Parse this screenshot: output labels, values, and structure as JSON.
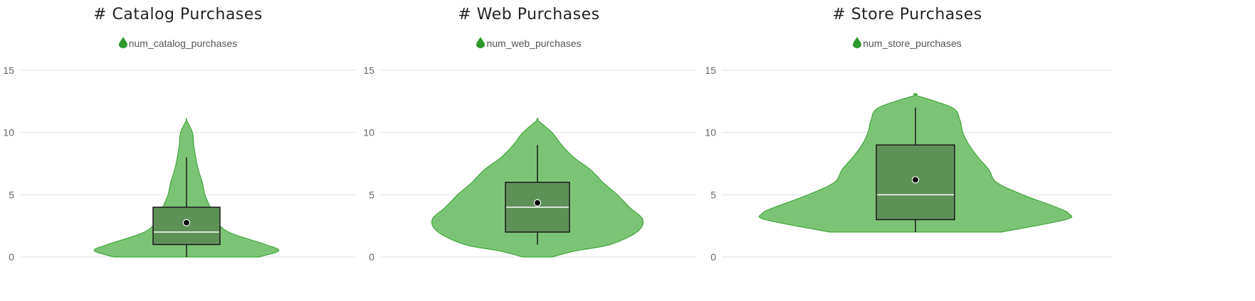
{
  "colors": {
    "violin_fill": "#7cc475",
    "violin_stroke": "#3fa63a",
    "box_fill": "#5e9158",
    "box_stroke": "#1a1a1a",
    "median": "#ffffff",
    "mean_dot": "#000000",
    "grid": "#e2e2e2",
    "legend_icon": "#2e9a2e"
  },
  "legend_icon": "droplet-icon",
  "chart_data": [
    {
      "type": "violin",
      "title": "# Catalog Purchases",
      "legend": "num_catalog_purchases",
      "ylim": [
        0,
        15
      ],
      "yticks": [
        0,
        5,
        10,
        15
      ],
      "grid": true,
      "box": {
        "min": 0,
        "q1": 1,
        "median": 2,
        "q3": 4,
        "max": 8,
        "mean": 2.75
      },
      "density": [
        [
          0,
          0.55
        ],
        [
          0.5,
          0.7
        ],
        [
          1,
          0.6
        ],
        [
          2,
          0.32
        ],
        [
          3,
          0.22
        ],
        [
          4,
          0.18
        ],
        [
          5,
          0.14
        ],
        [
          6,
          0.12
        ],
        [
          7,
          0.09
        ],
        [
          8,
          0.07
        ],
        [
          9,
          0.055
        ],
        [
          10,
          0.045
        ],
        [
          11,
          0
        ]
      ]
    },
    {
      "type": "violin",
      "title": "# Web Purchases",
      "legend": "num_web_purchases",
      "ylim": [
        0,
        15
      ],
      "yticks": [
        0,
        5,
        10,
        15
      ],
      "grid": true,
      "box": {
        "min": 1,
        "q1": 2,
        "median": 4,
        "q3": 6,
        "max": 9,
        "mean": 4.35
      },
      "density": [
        [
          0,
          0.12
        ],
        [
          0.5,
          0.32
        ],
        [
          1,
          0.6
        ],
        [
          2,
          0.82
        ],
        [
          3,
          0.87
        ],
        [
          4,
          0.76
        ],
        [
          5,
          0.66
        ],
        [
          6,
          0.54
        ],
        [
          7,
          0.44
        ],
        [
          8,
          0.3
        ],
        [
          9,
          0.2
        ],
        [
          10,
          0.12
        ],
        [
          11,
          0
        ]
      ]
    },
    {
      "type": "violin",
      "title": "# Store Purchases",
      "legend": "num_store_purchases",
      "ylim": [
        0,
        15
      ],
      "yticks": [
        0,
        5,
        10,
        15
      ],
      "grid": true,
      "box": {
        "min": 2,
        "q1": 3,
        "median": 5,
        "q3": 9,
        "max": 12,
        "mean": 6.2
      },
      "density": [
        [
          2,
          0.56
        ],
        [
          3,
          0.98
        ],
        [
          3.5,
          1.0
        ],
        [
          4,
          0.92
        ],
        [
          5,
          0.7
        ],
        [
          6,
          0.53
        ],
        [
          7,
          0.48
        ],
        [
          8,
          0.41
        ],
        [
          9,
          0.35
        ],
        [
          10,
          0.31
        ],
        [
          11,
          0.29
        ],
        [
          12,
          0.24
        ],
        [
          13,
          0
        ]
      ]
    }
  ]
}
